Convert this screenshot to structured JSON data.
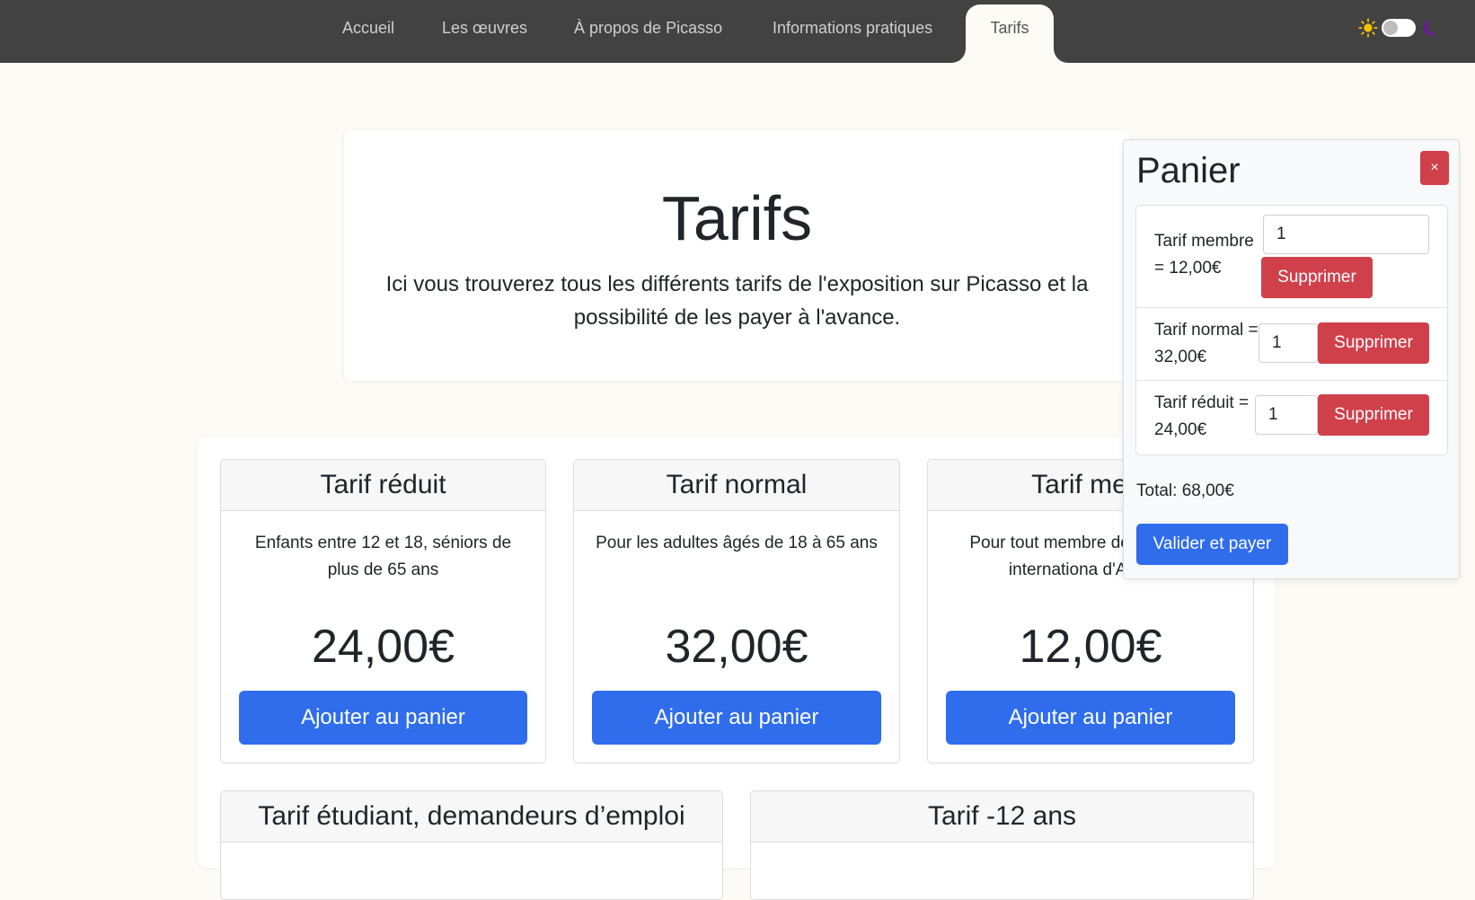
{
  "nav": {
    "items": [
      {
        "label": "Accueil"
      },
      {
        "label": "Les œuvres"
      },
      {
        "label": "À propos de Picasso"
      },
      {
        "label": "Informations pratiques"
      },
      {
        "label": "Tarifs"
      }
    ],
    "active": "Tarifs",
    "theme_toggle": {
      "state": "off",
      "colors": {
        "sun": "#f2c200",
        "moon": "#6a1b9a"
      }
    }
  },
  "hero": {
    "title": "Tarifs",
    "text": "Ici vous trouverez tous les différents tarifs de l'exposition sur Picasso et la possibilité de les payer à l'avance."
  },
  "tarifs": [
    {
      "title": "Tarif réduit",
      "description": "Enfants entre 12 et 18, séniors de plus de 65 ans",
      "price": "24,00€",
      "button": "Ajouter au panier"
    },
    {
      "title": "Tarif normal",
      "description": "Pour les adultes âgés de 18 à 65 ans",
      "price": "32,00€",
      "button": "Ajouter au panier"
    },
    {
      "title": "Tarif mem",
      "description": "Pour tout membre de du festival internationa d'Annecy",
      "price": "12,00€",
      "button": "Ajouter au panier"
    },
    {
      "title": "Tarif étudiant, demandeurs d’emploi"
    },
    {
      "title": "Tarif -12 ans"
    }
  ],
  "cart": {
    "title": "Panier",
    "close": "×",
    "items": [
      {
        "label": "Tarif membre = 12,00€",
        "qty": "1",
        "remove": "Supprimer"
      },
      {
        "label": "Tarif normal = 32,00€",
        "qty": "1",
        "remove": "Supprimer"
      },
      {
        "label": "Tarif réduit = 24,00€",
        "qty": "1",
        "remove": "Supprimer"
      }
    ],
    "total": "Total: 68,00€",
    "pay": "Valider et payer"
  },
  "colors": {
    "navbar": "#424242",
    "primary": "#2f6ded",
    "danger": "#d0404b",
    "background": "#fdfbf6"
  }
}
